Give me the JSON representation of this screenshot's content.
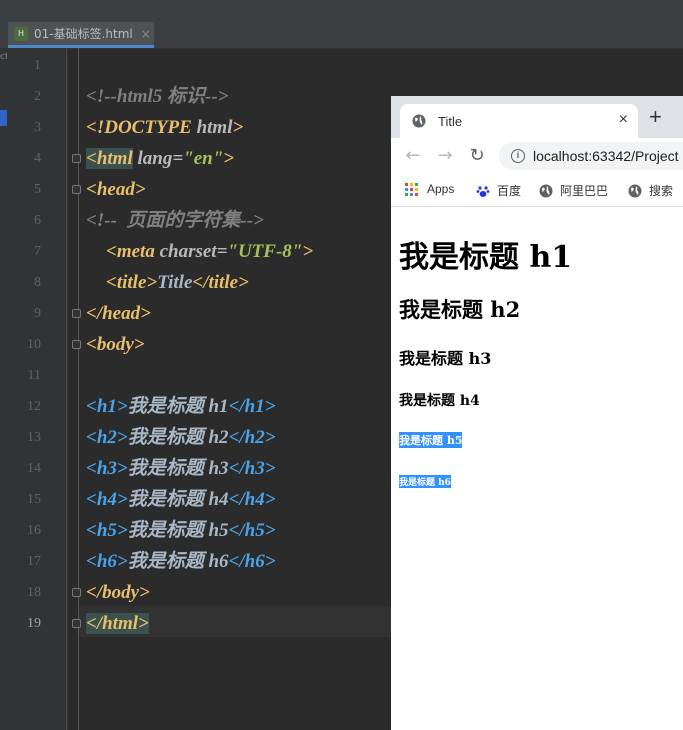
{
  "ide": {
    "file_tab": {
      "icon_label": "H",
      "name": "01-基础标签.html",
      "close": "×"
    },
    "left_strip_text": "ct",
    "line_numbers": [
      "1",
      "2",
      "3",
      "4",
      "5",
      "6",
      "7",
      "8",
      "9",
      "10",
      "11",
      "12",
      "13",
      "14",
      "15",
      "16",
      "17",
      "18",
      "19"
    ],
    "code": {
      "l2": "<!--html5 标识-->",
      "l3_tag": "<!DOCTYPE",
      "l3_attr": " html",
      "l3_close": ">",
      "l4_open": "<html",
      "l4_attr": " lang=",
      "l4_str": "\"en\"",
      "l4_close": ">",
      "l5": "<head>",
      "l6": "<!--  页面的字符集-->",
      "l7_open": "<meta",
      "l7_attr": " charset=",
      "l7_str": "\"UTF-8\"",
      "l7_close": ">",
      "l8_open": "<title>",
      "l8_text": "Title",
      "l8_close": "</title>",
      "l9": "</head>",
      "l10": "<body>",
      "l12_open": "<h1>",
      "l12_text": "我是标题 h1",
      "l12_close": "</h1>",
      "l13_open": "<h2>",
      "l13_text": "我是标题 h2",
      "l13_close": "</h2>",
      "l14_open": "<h3>",
      "l14_text": "我是标题 h3",
      "l14_close": "</h3>",
      "l15_open": "<h4>",
      "l15_text": "我是标题 h4",
      "l15_close": "</h4>",
      "l16_open": "<h5>",
      "l16_text": "我是标题 h5",
      "l16_close": "</h5>",
      "l17_open": "<h6>",
      "l17_text": "我是标题 h6",
      "l17_close": "</h6>",
      "l18": "</body>",
      "l19": "</html>"
    }
  },
  "browser": {
    "tab_title": "Title",
    "tab_close": "×",
    "new_tab": "+",
    "url": "localhost:63342/Project",
    "bookmarks": [
      "Apps",
      "百度",
      "阿里巴巴",
      "搜索"
    ],
    "headings": {
      "h1": "我是标题 h1",
      "h2": "我是标题 h2",
      "h3": "我是标题 h3",
      "h4": "我是标题 h4",
      "h5": "我是标题 h5",
      "h6": "我是标题 h6"
    }
  },
  "colors": {
    "editor_bg": "#2b2b2b",
    "tag": "#e8bf6a",
    "heading_tag": "#4aa3e8",
    "string": "#a5c25c",
    "comment": "#808080",
    "selection": "#3390ff"
  }
}
